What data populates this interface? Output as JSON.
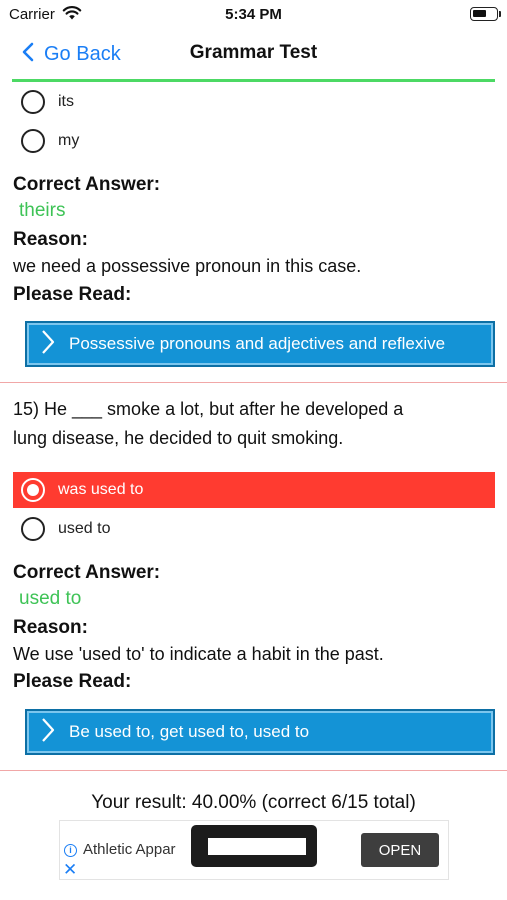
{
  "status_bar": {
    "carrier": "Carrier",
    "time": "5:34 PM"
  },
  "nav": {
    "back_label": "Go Back",
    "title": "Grammar Test"
  },
  "question_14": {
    "options": [
      {
        "label": "its",
        "selected": false
      },
      {
        "label": "my",
        "selected": false
      }
    ],
    "correct_answer_label": "Correct Answer:",
    "correct_answer": "theirs",
    "reason_label": "Reason:",
    "reason": "we need a possessive pronoun in this case.",
    "please_read_label": "Please Read:",
    "read_link": "Possessive pronouns and adjectives and reflexive"
  },
  "question_15": {
    "text_line1": "15) He ___ smoke a lot, but after he developed a",
    "text_line2": "lung disease, he decided to quit smoking.",
    "options": [
      {
        "label": "was used to",
        "selected": true
      },
      {
        "label": "used to",
        "selected": false
      }
    ],
    "correct_answer_label": "Correct Answer:",
    "correct_answer": "used to",
    "reason_label": "Reason:",
    "reason": "We use 'used to' to indicate a habit in the past.",
    "please_read_label": "Please Read:",
    "read_link": "Be used to, get used to, used to"
  },
  "result": {
    "text": "Your result: 40.00% (correct 6/15 total)"
  },
  "ad": {
    "info_icon": "i",
    "text": "Athletic Appar",
    "close": "✕",
    "open_label": "OPEN"
  },
  "colors": {
    "accent_blue": "#1a7ef5",
    "correct_green": "#3ec356",
    "wrong_red": "#ff3b30",
    "read_button_blue": "#1493d6",
    "progress_green": "#4cd964"
  }
}
